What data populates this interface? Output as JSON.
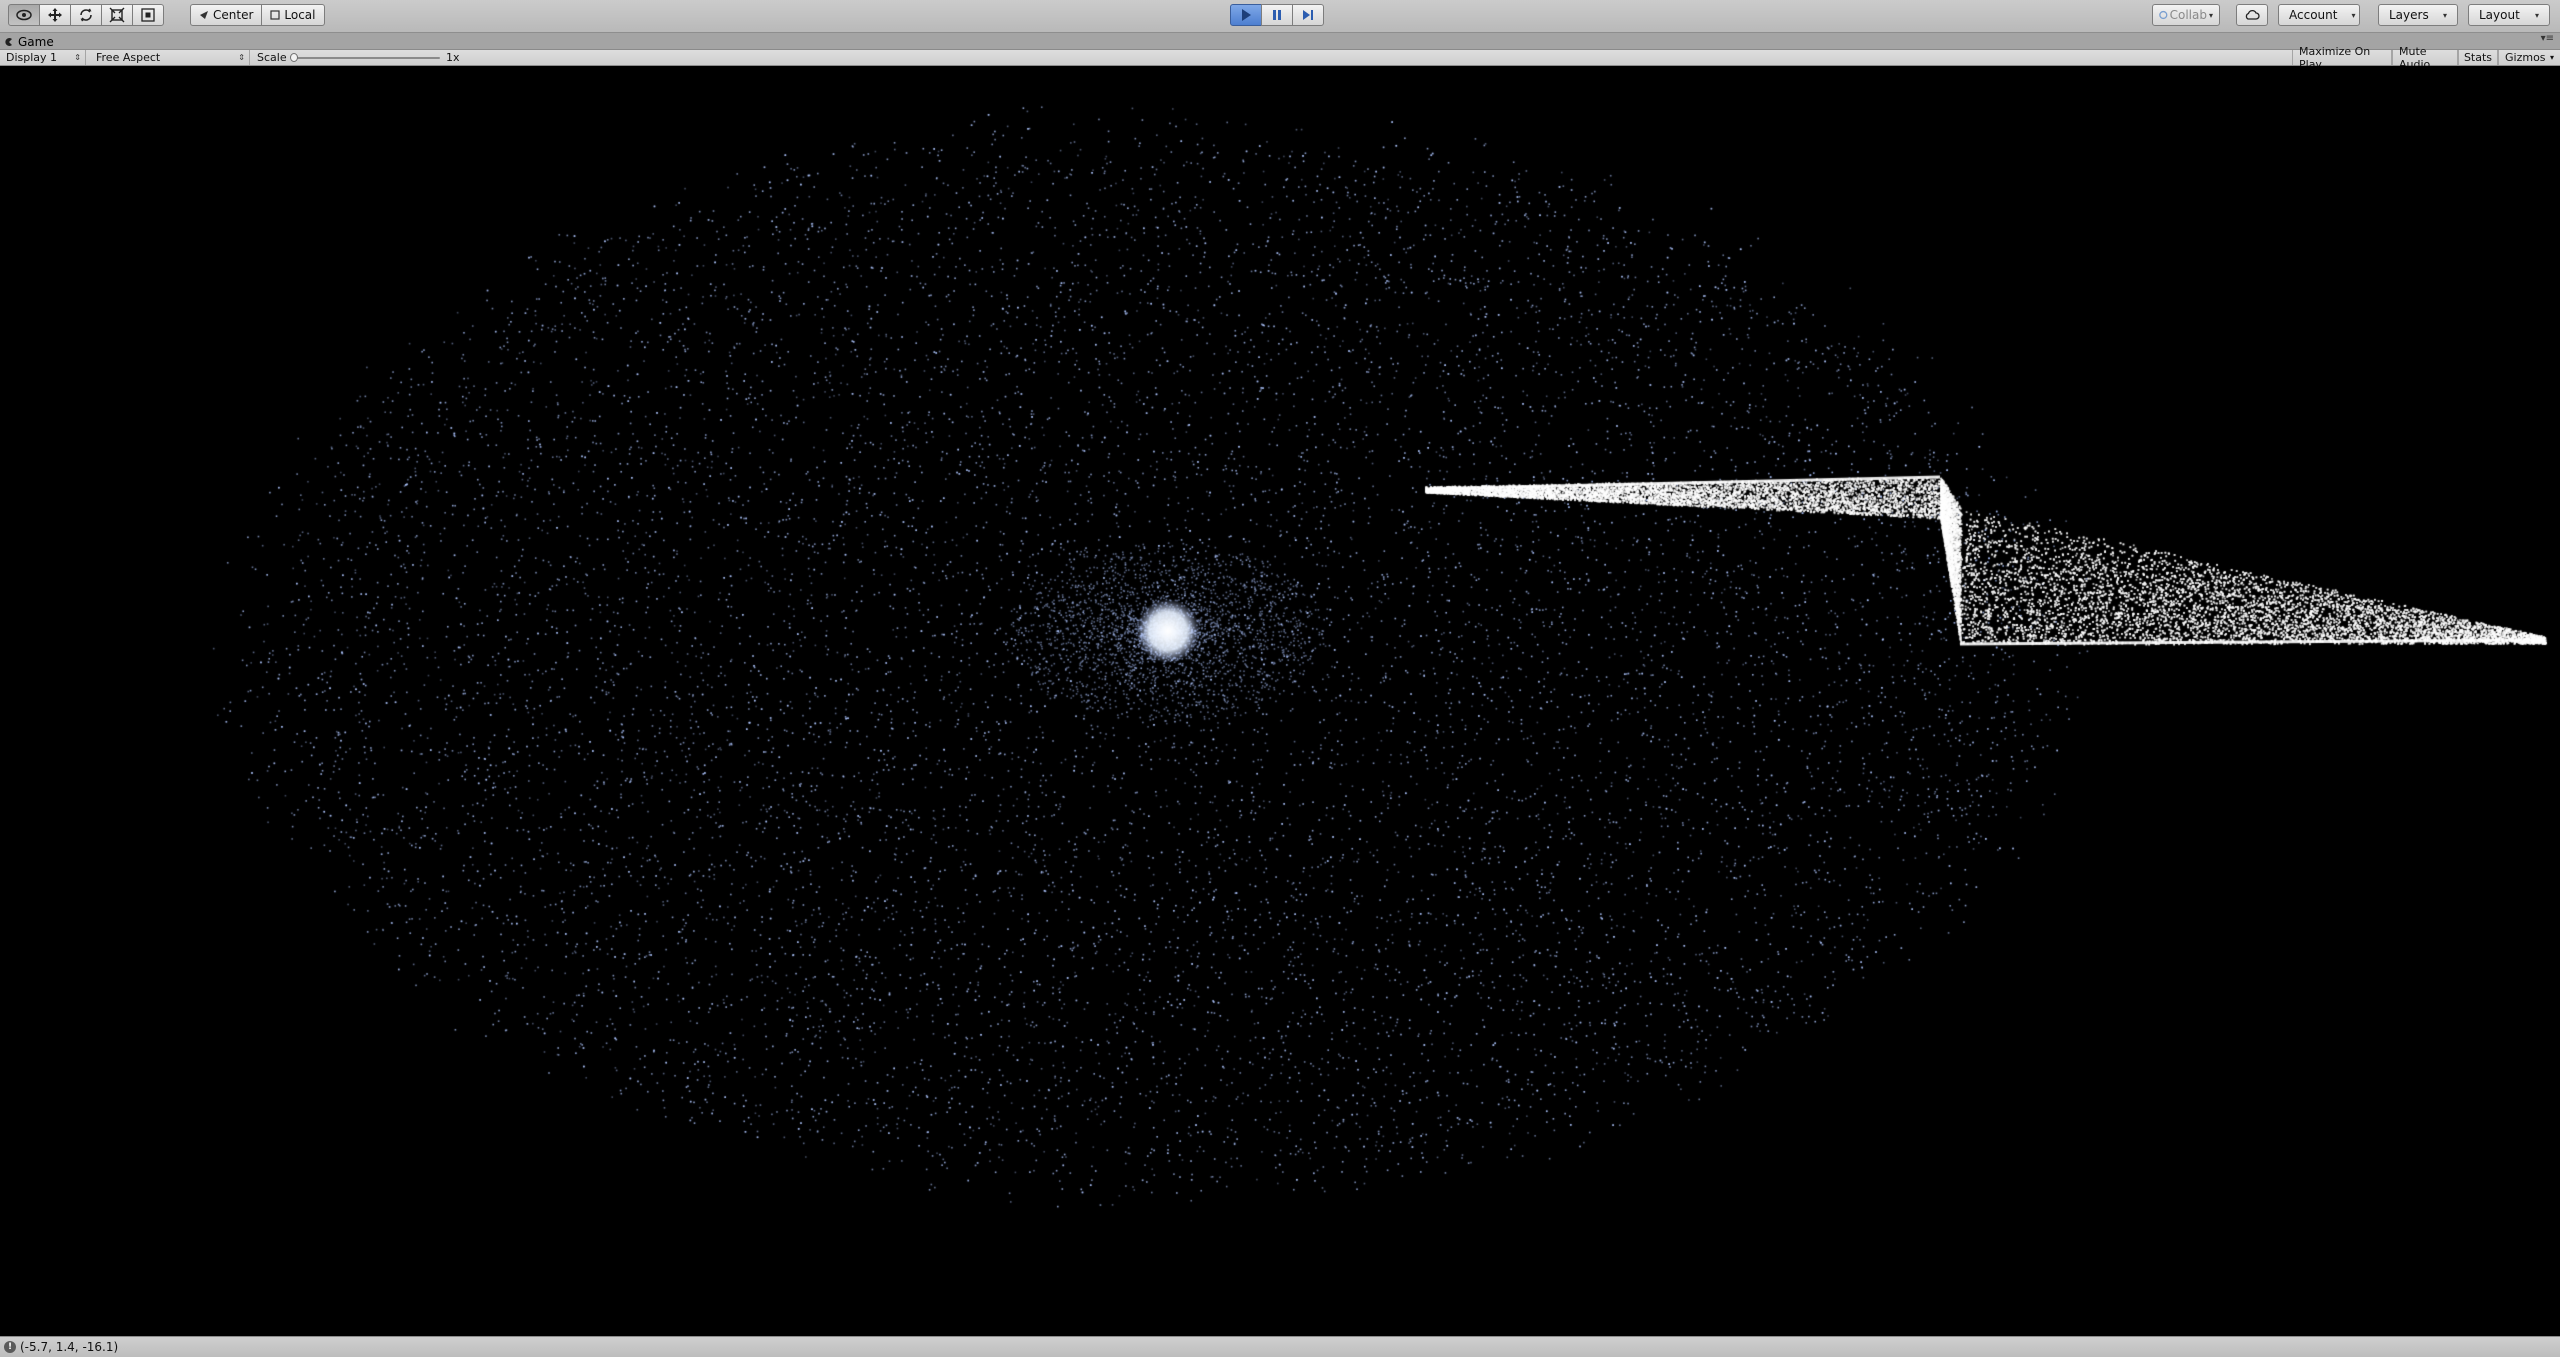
{
  "toolbar": {
    "tools": [
      {
        "icon": "view-tool-icon"
      },
      {
        "icon": "move-tool-icon"
      },
      {
        "icon": "rotate-tool-icon"
      },
      {
        "icon": "scale-tool-icon"
      },
      {
        "icon": "rect-tool-icon"
      }
    ],
    "pivot_center_label": "Center",
    "pivot_local_label": "Local",
    "play_state": "playing",
    "collab_label": "Collab",
    "account_label": "Account",
    "layers_label": "Layers",
    "layout_label": "Layout"
  },
  "panel": {
    "tab_label": "Game"
  },
  "gamebar": {
    "display_label": "Display 1",
    "aspect_label": "Free Aspect",
    "scale_label": "Scale",
    "scale_value": "1x",
    "maximize_label": "Maximize On Play",
    "mute_label": "Mute Audio",
    "stats_label": "Stats",
    "gizmos_label": "Gizmos"
  },
  "scene": {
    "background": "#000000",
    "particle_color": "#aec6ff",
    "description_type": "particle galaxy simulation"
  },
  "status": {
    "message": "(-5.7, 1.4, -16.1)"
  },
  "colors": {
    "accent_play": "#4d7fd0",
    "toolbar_bg": "#c3c3c3"
  }
}
